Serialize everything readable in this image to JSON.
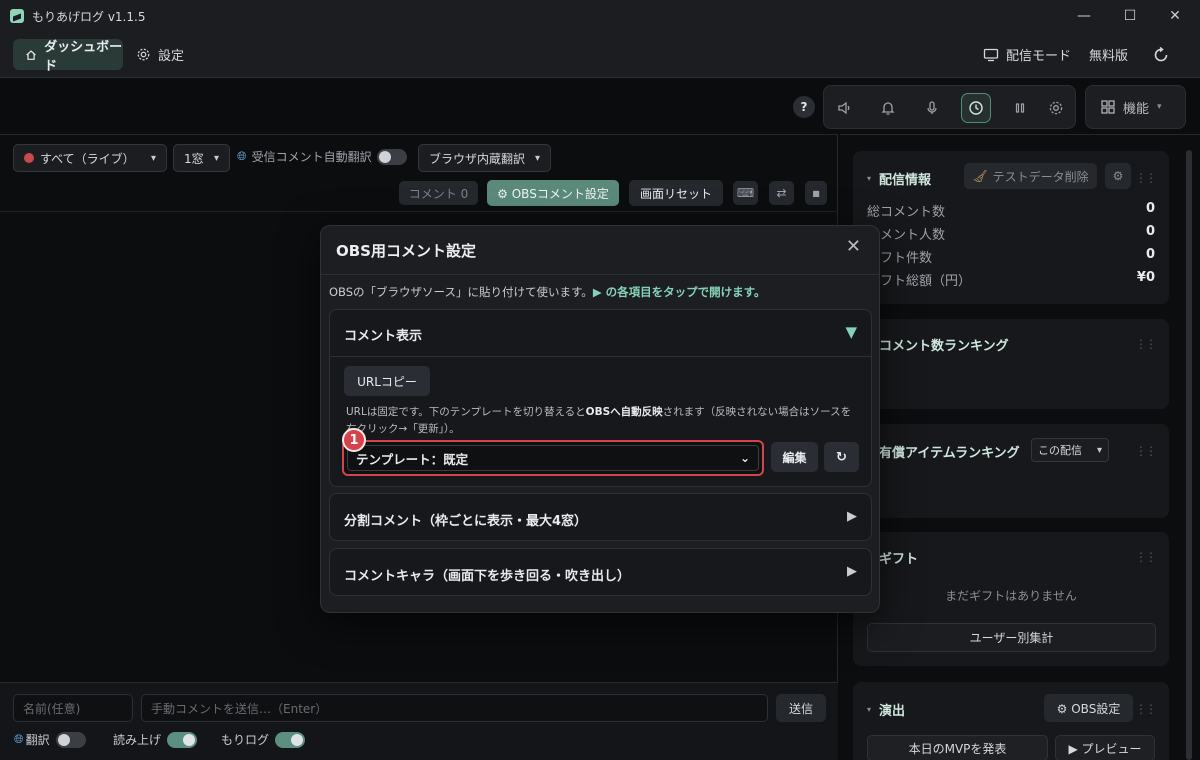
{
  "app": {
    "title": "もりあげログ  v1.1.5"
  },
  "window_controls": {
    "minimize": "—",
    "maximize": "☐",
    "close": "✕"
  },
  "nav": {
    "dashboard": "ダッシュボード",
    "settings": "設定",
    "broadcast_mode": "配信モード",
    "plan": "無料版"
  },
  "toolbar": {
    "help": "?",
    "feature_label": "機能"
  },
  "left": {
    "filter_value": "すべて（ライブ）",
    "window_count": "1窓",
    "auto_translate_label": "受信コメント自動翻訳",
    "translate_engine": "ブラウザ内蔵翻訳",
    "comment_count": "コメント 0",
    "obs_comment_settings": "⚙ OBSコメント設定",
    "screen_reset": "画面リセット"
  },
  "bottom": {
    "name_placeholder": "名前(任意)",
    "comment_placeholder": "手動コメントを送信…（Enter）",
    "send": "送信",
    "translate_label": "翻訳",
    "read_aloud_label": "読み上げ",
    "morilog_label": "もりログ"
  },
  "right": {
    "info": {
      "title": "配信情報",
      "delete_test": "テストデータ削除",
      "stats": [
        {
          "label": "総コメント数",
          "value": "0"
        },
        {
          "label": "コメント人数",
          "value": "0"
        },
        {
          "label": "ギフト件数",
          "value": "0"
        },
        {
          "label": "ギフト総額（円）",
          "value": "¥0"
        }
      ]
    },
    "comment_ranking": {
      "title": "コメント数ランキング"
    },
    "paid_ranking": {
      "title": "有償アイテムランキング",
      "scope": "この配信"
    },
    "gift": {
      "title": "ギフト",
      "empty": "まだギフトはありません",
      "per_user": "ユーザー別集計"
    },
    "effects": {
      "title": "演出",
      "obs_settings": "⚙ OBS設定",
      "mvp": "本日のMVPを発表",
      "preview": "▶ プレビュー"
    }
  },
  "modal": {
    "title": "OBS用コメント設定",
    "desc_plain": "OBSの「ブラウザソース」に貼り付けて使います。",
    "desc_hl": "▶ の各項目をタップで開けます。",
    "section1": {
      "title": "コメント表示",
      "url_copy": "URLコピー",
      "note_a": "URLは固定です。下のテンプレートを切り替えると",
      "note_b": "OBSへ自動反映",
      "note_c": "されます（反映されない場合はソースを右クリック→「更新」）。",
      "template_value": "テンプレート：既定",
      "edit": "編集",
      "reload": "↻"
    },
    "section2": {
      "title": "分割コメント（枠ごとに表示・最大4窓）"
    },
    "section3": {
      "title": "コメントキャラ（画面下を歩き回る・吹き出し）"
    },
    "marker": "1"
  },
  "colors": {
    "accent": "#86d2b8",
    "highlight_red": "#d4444c",
    "panel": "#17181b"
  }
}
